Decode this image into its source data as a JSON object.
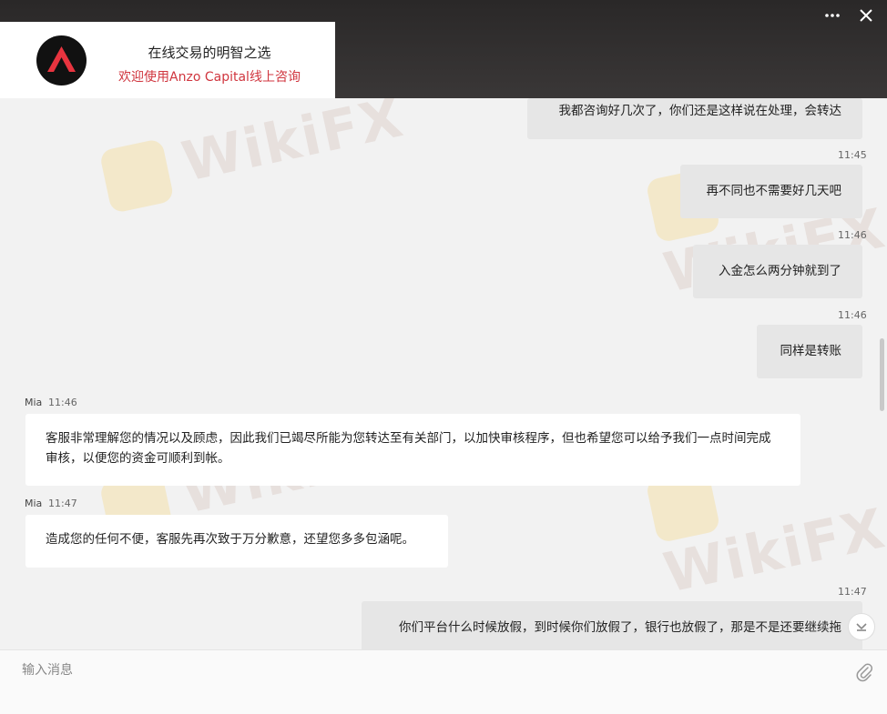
{
  "header": {
    "title": "在线交易的明智之选",
    "subtitle": "欢迎使用Anzo Capital线上咨询"
  },
  "watermark": {
    "text": "WikiFX"
  },
  "messages": [
    {
      "direction": "out",
      "time": "",
      "text": "我都咨询好几次了，你们还是这样说在处理，会转达"
    },
    {
      "direction": "out",
      "time": "11:45",
      "text": "再不同也不需要好几天吧"
    },
    {
      "direction": "out",
      "time": "11:46",
      "text": "入金怎么两分钟就到了"
    },
    {
      "direction": "out",
      "time": "11:46",
      "text": "同样是转账"
    },
    {
      "direction": "in",
      "sender": "Mia",
      "time": "11:46",
      "text": "客服非常理解您的情况以及顾虑，因此我们已竭尽所能为您转达至有关部门，以加快审核程序，但也希望您可以给予我们一点时间完成审核，以便您的资金可顺利到帐。"
    },
    {
      "direction": "in",
      "sender": "Mia",
      "time": "11:47",
      "text": "造成您的任何不便，客服先再次致于万分歉意，还望您多多包涵呢。"
    },
    {
      "direction": "out",
      "time": "11:47",
      "text": "你们平台什么时候放假，到时候你们放假了，银行也放假了，那是不是还要继续拖"
    }
  ],
  "composer": {
    "placeholder": "输入消息"
  },
  "colors": {
    "accent": "#d0363f",
    "header_bg": "#2f2d2d",
    "out_bubble": "#e6e6e6"
  },
  "icons": {
    "more": "more-dots-icon",
    "close": "close-icon",
    "attach": "paperclip-icon",
    "jump": "chevron-down-icon"
  }
}
